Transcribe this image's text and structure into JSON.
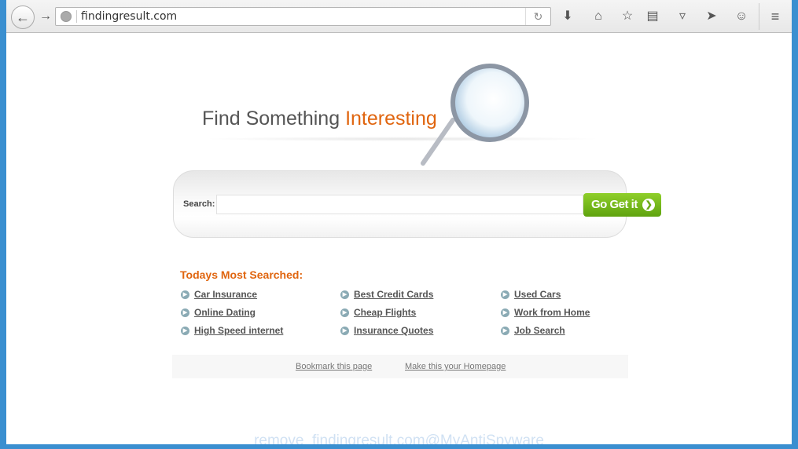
{
  "browser": {
    "url": "findingresult.com",
    "icons": [
      "back-icon",
      "forward-icon",
      "globe-icon",
      "reload-icon",
      "download-icon",
      "home-icon",
      "bookmark-star-icon",
      "reading-list-icon",
      "pocket-icon",
      "send-icon",
      "smiley-icon",
      "menu-icon"
    ]
  },
  "page": {
    "heading_part1": "Find Something",
    "heading_part2": "Interesting",
    "search_label": "Search:",
    "search_value": "",
    "go_button": "Go Get it",
    "most_searched_title": "Todays Most Searched:",
    "links": [
      [
        "Car Insurance",
        "Best Credit Cards",
        "Used Cars"
      ],
      [
        "Online Dating",
        "Cheap Flights",
        "Work from Home"
      ],
      [
        "High Speed internet",
        "Insurance Quotes",
        "Job Search"
      ]
    ],
    "footer": {
      "bookmark": "Bookmark this page",
      "homepage": "Make this your Homepage"
    },
    "watermark": "remove_findingresult.com@MyAntiSpyware"
  },
  "colors": {
    "accent_orange": "#e0650f",
    "button_green": "#6fb81b",
    "window_blue": "#3a8fd0"
  }
}
